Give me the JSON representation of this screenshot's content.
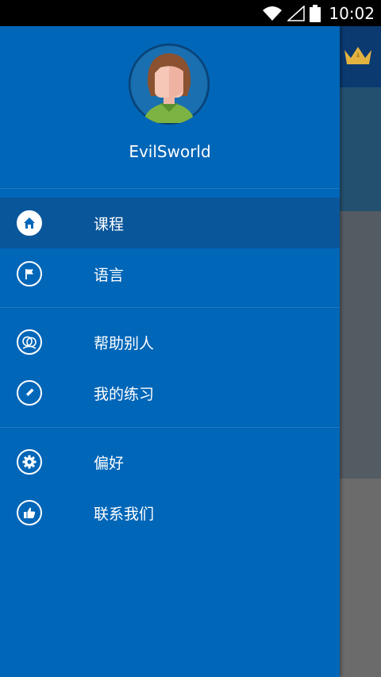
{
  "status_bar": {
    "time": "10:02",
    "icons": [
      "wifi-icon",
      "signal-icon",
      "battery-icon"
    ]
  },
  "profile": {
    "username": "EvilSworld",
    "avatar_icon": "user-avatar-icon"
  },
  "menu": {
    "items": [
      {
        "label": "课程",
        "icon": "home-icon",
        "active": true
      },
      {
        "label": "语言",
        "icon": "flag-icon"
      },
      {
        "label": "帮助别人",
        "icon": "people-icon"
      },
      {
        "label": "我的练习",
        "icon": "pencil-icon"
      },
      {
        "label": "偏好",
        "icon": "gear-icon"
      },
      {
        "label": "联系我们",
        "icon": "thumbs-up-icon"
      }
    ]
  },
  "colors": {
    "drawer": "#0066b8",
    "active_item": "#0a569a",
    "status_bar": "#000000"
  }
}
